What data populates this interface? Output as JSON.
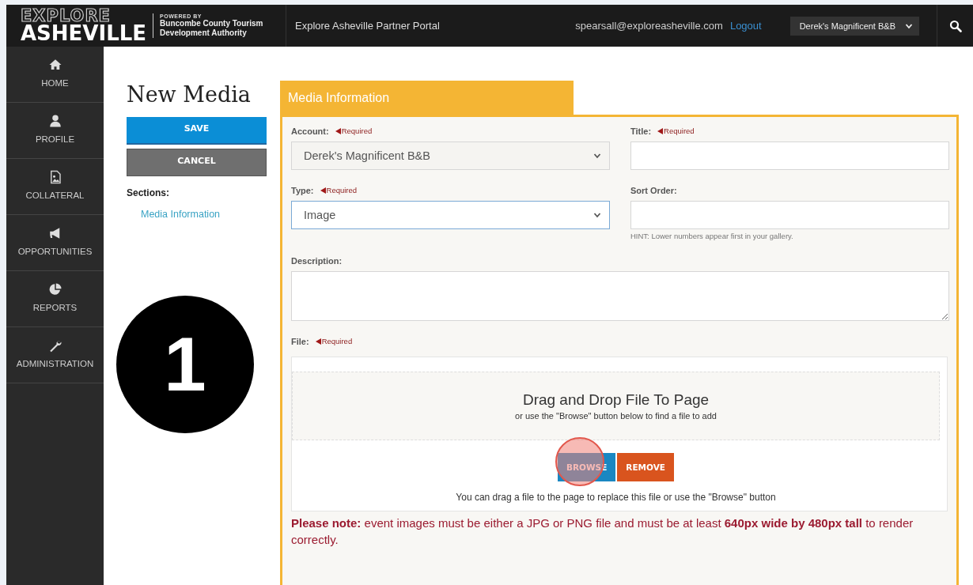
{
  "header": {
    "logo_top": "EXPLORE",
    "logo_bottom": "ASHEVILLE",
    "powered_by": "POWERED BY",
    "authority_lines": [
      "Buncombe County Tourism",
      "Development Authority"
    ],
    "portal_title": "Explore Asheville Partner Portal",
    "user_email": "spearsall@exploreasheville.com",
    "logout": "Logout",
    "account_select": "Derek's Magnificent B&B"
  },
  "sidebar": {
    "items": [
      {
        "label": "HOME"
      },
      {
        "label": "PROFILE"
      },
      {
        "label": "COLLATERAL"
      },
      {
        "label": "OPPORTUNITIES"
      },
      {
        "label": "REPORTS"
      },
      {
        "label": "ADMINISTRATION"
      }
    ]
  },
  "page": {
    "title": "New Media",
    "buttons": [
      {
        "label": "SAVE",
        "kind": "primary"
      },
      {
        "label": "CANCEL",
        "kind": "secondary"
      }
    ],
    "sections_label": "Sections:",
    "section_links": [
      "Media Information"
    ]
  },
  "panel": {
    "tab": "Media Information",
    "fields": [
      {
        "label": "Account:",
        "required_note": "Required",
        "kind": "select",
        "value": "Derek's Magnificent B&B",
        "disabled": true,
        "focused": false
      },
      {
        "label": "Title:",
        "required_note": "Required",
        "kind": "text",
        "disabled": false,
        "focused": false
      },
      {
        "label": "Type:",
        "required_note": "Required",
        "kind": "select",
        "value": "Image",
        "disabled": false,
        "focused": true
      },
      {
        "label": "Sort Order:",
        "kind": "text",
        "hint": "HINT: Lower numbers appear first in your gallery.",
        "disabled": false,
        "focused": false
      },
      {
        "label": "Description:",
        "kind": "textarea",
        "disabled": false,
        "focused": false
      }
    ],
    "file": {
      "label": "File:",
      "required_note": "Required",
      "drop_title": "Drag and Drop File To Page",
      "drop_subtitle": "or use the \"Browse\" button below to find a file to add",
      "browse": "BROWSE",
      "remove": "REMOVE",
      "browse_highlighted": true,
      "replace_note": "You can drag a file to the page to replace this file or use the \"Browse\" button"
    },
    "note": "**Please note:** event images must be either a JPG or PNG file and must be at least **640px wide by 480px tall** to render correctly."
  },
  "step_badge": "1"
}
